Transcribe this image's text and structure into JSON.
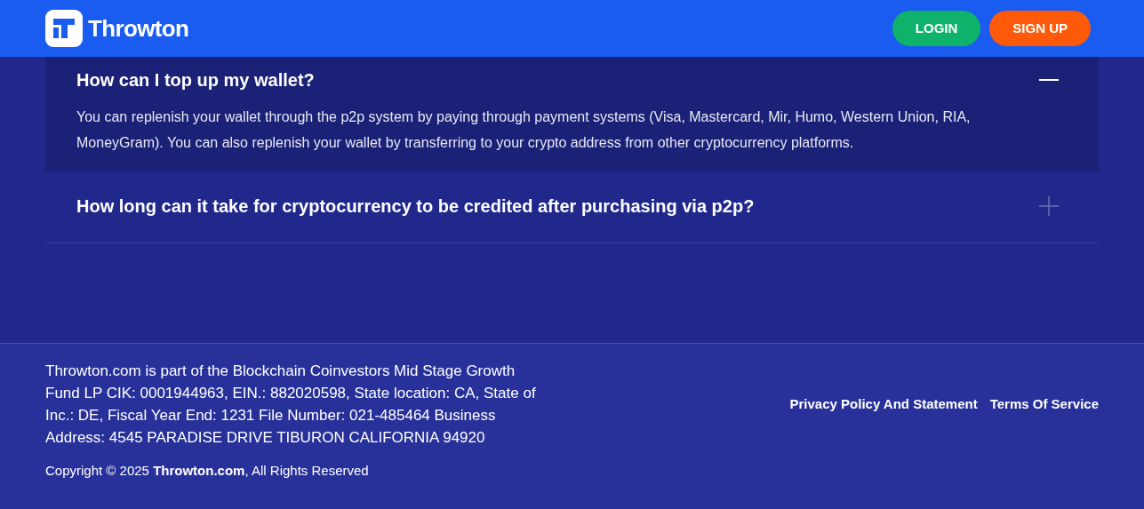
{
  "header": {
    "logo_text": "Throwton",
    "buttons": [
      {
        "kind": "login",
        "label": "LOGIN"
      },
      {
        "kind": "signup",
        "label": "SIGN UP"
      }
    ]
  },
  "faq": [
    {
      "question": "How can I top up my wallet?",
      "expanded": true,
      "answer": "You can replenish your wallet through the p2p system by paying through payment systems (Visa, Mastercard, Mir, Humo, Western Union, RIA, MoneyGram). You can also replenish your wallet by transferring to your crypto address from other cryptocurrency platforms."
    },
    {
      "question": "How long can it take for cryptocurrency to be credited after purchasing via p2p?",
      "expanded": false
    }
  ],
  "footer": {
    "about": "Throwton.com is part of the Blockchain Coinvestors Mid Stage Growth Fund LP CIK: 0001944963, EIN.: 882020598, State location: CA, State of Inc.: DE, Fiscal Year End: 1231 File Number: 021-485464 Business Address: 4545 PARADISE DRIVE TIBURON CALIFORNIA 94920",
    "copyright": "Copyright © 2025 **Throwton.com**, All Rights Reserved",
    "links": [
      "Privacy Policy And Statement",
      "Terms Of Service"
    ]
  }
}
